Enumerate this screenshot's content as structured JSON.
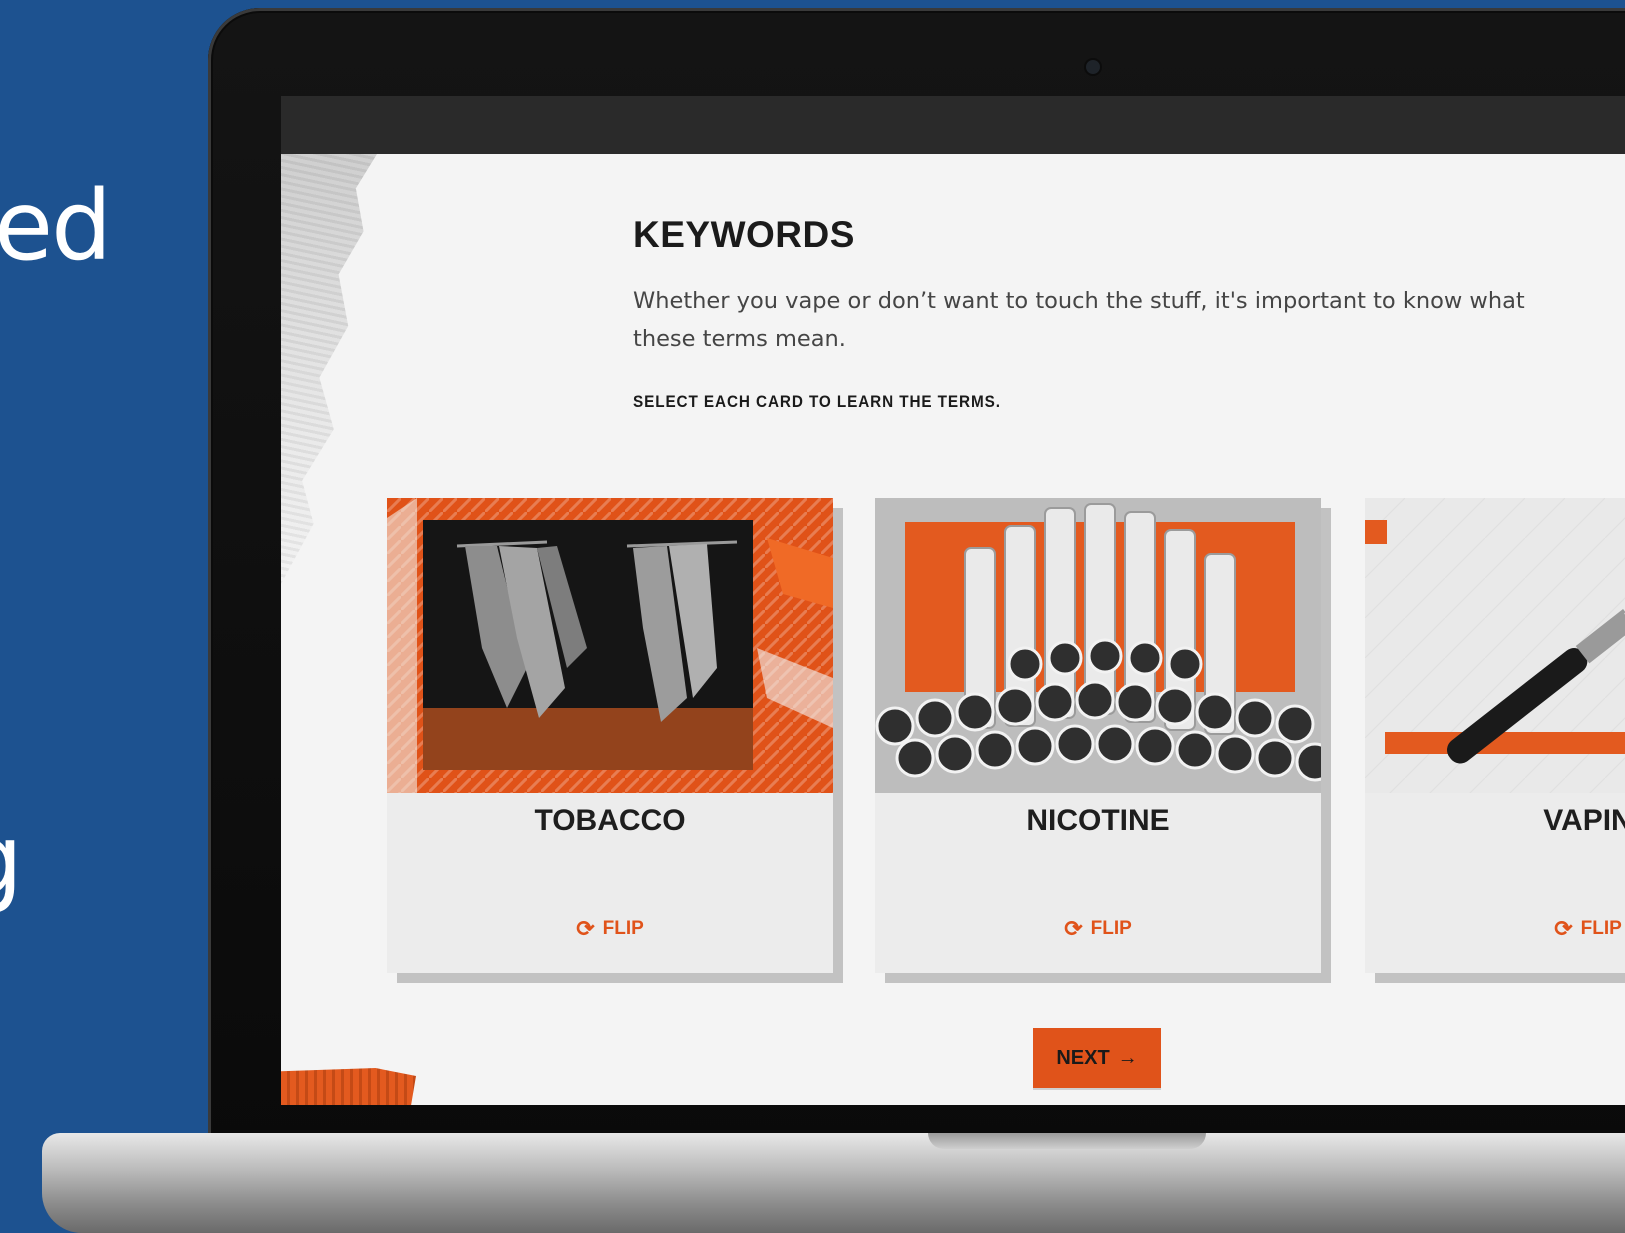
{
  "side_text": [
    "ed",
    "g"
  ],
  "page": {
    "heading": "KEYWORDS",
    "intro": "Whether you vape or don’t want to touch the stuff,  it's important to know what these terms mean.",
    "instruction": "SELECT EACH CARD TO LEARN THE TERMS."
  },
  "cards": [
    {
      "title": "TOBACCO",
      "flip_label": "FLIP",
      "flip_icon": "refresh-icon"
    },
    {
      "title": "NICOTINE",
      "flip_label": "FLIP",
      "flip_icon": "refresh-icon"
    },
    {
      "title": "VAPIN",
      "flip_label": "FLIP",
      "flip_icon": "refresh-icon"
    }
  ],
  "next_button": {
    "label": "NEXT",
    "icon": "arrow-right-icon"
  },
  "colors": {
    "accent": "#e0531a",
    "background": "#1d5290",
    "page": "#f4f4f4"
  }
}
